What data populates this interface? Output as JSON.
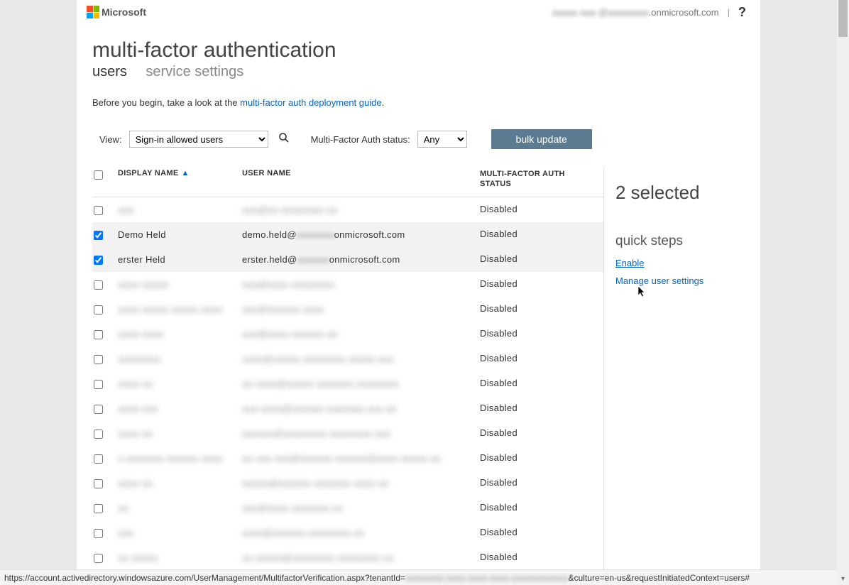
{
  "header": {
    "logo_text": "Microsoft",
    "email_prefix_blur": "aaaaa aaa @aaaaaaaa",
    "email_suffix": ".onmicrosoft.com",
    "separator": "|",
    "help": "?"
  },
  "page": {
    "title": "multi-factor authentication",
    "tab_users": "users",
    "tab_settings": "service settings"
  },
  "intro": {
    "before_text": "Before you begin, take a look at the ",
    "link_text": "multi-factor auth deployment guide",
    "after_text": "."
  },
  "filters": {
    "view_label": "View:",
    "view_value": "Sign-in allowed users",
    "mfa_label": "Multi-Factor Auth status:",
    "mfa_value": "Any",
    "bulk_button": "bulk update"
  },
  "columns": {
    "display_name": "DISPLAY NAME",
    "user_name": "USER NAME",
    "mfa_status": "MULTI-FACTOR AUTH STATUS"
  },
  "rows": [
    {
      "checked": false,
      "name_blur": "aaa",
      "user_blur": "aaa@aa aaaaaaaa aa",
      "status": "Disabled",
      "clear": false
    },
    {
      "checked": true,
      "name": "Demo Held",
      "user_prefix": "demo.held@",
      "user_mid_blur": "aaaaaaa",
      "user_suffix": "onmicrosoft.com",
      "status": "Disabled",
      "clear": true
    },
    {
      "checked": true,
      "name": "erster Held",
      "user_prefix": "erster.held@",
      "user_mid_blur": "aaaaaa",
      "user_suffix": "onmicrosoft.com",
      "status": "Disabled",
      "clear": true
    },
    {
      "checked": false,
      "name_blur": "aaaa aaaaa",
      "user_blur": "aaa@aaaa aaaaaaaa",
      "status": "Disabled",
      "clear": false
    },
    {
      "checked": false,
      "name_blur": "aaaa aaaaa  aaaaa aaaa",
      "user_blur": "aaa@aaaaaa aaaa",
      "status": "Disabled",
      "clear": false
    },
    {
      "checked": false,
      "name_blur": "aaaa aaaa",
      "user_blur": "aaa@aaaa aaaaaa aa",
      "status": "Disabled",
      "clear": false
    },
    {
      "checked": false,
      "name_blur": "aaaaaaaa",
      "user_blur": "aaaa@aaaaa aaaaaaaa aaaaa aaa",
      "status": "Disabled",
      "clear": false
    },
    {
      "checked": false,
      "name_blur": "aaaa aa",
      "user_blur": "aa aaaa@aaaaa aaaaaaa aaaaaaaa",
      "status": "Disabled",
      "clear": false
    },
    {
      "checked": false,
      "name_blur": "aaaa aaa",
      "user_blur": "aaa aaaa@aaaaaa aaaaaaa aaa aa",
      "status": "Disabled",
      "clear": false
    },
    {
      "checked": false,
      "name_blur": "aaaa aa",
      "user_blur": "aaaaaa@aaaaaaaa aaaaaaaa aaa",
      "status": "Disabled",
      "clear": false
    },
    {
      "checked": false,
      "name_blur": "a aaaaaaa aaaaaa aaaa",
      "user_blur": "aa aaa aaa@aaaaaa aaaaaa@aaaa aaaaa aa",
      "status": "Disabled",
      "clear": false
    },
    {
      "checked": false,
      "name_blur": "aaaa aa",
      "user_blur": "aaaaa@aaaaaa aaaaaaa aaaa aa",
      "status": "Disabled",
      "clear": false
    },
    {
      "checked": false,
      "name_blur": "aa",
      "user_blur": "aaa@aaaa aaaaaaa aa",
      "status": "Disabled",
      "clear": false
    },
    {
      "checked": false,
      "name_blur": "aaa",
      "user_blur": "aaaa@aaaaaa aaaaaaaa aa",
      "status": "Disabled",
      "clear": false
    },
    {
      "checked": false,
      "name_blur": "aa aaaaa",
      "user_blur": "aa aaaaa@aaaaaaaa aaaaaaaa aa",
      "status": "Disabled",
      "clear": false
    }
  ],
  "side": {
    "selected_title": "2 selected",
    "quick_steps": "quick steps",
    "enable": "Enable",
    "manage": "Manage user settings"
  },
  "status_bar": {
    "prefix": "https://account.activedirectory.windowsazure.com/UserManagement/MultifactorVerification.aspx?tenantId=",
    "mid_blur": "aaaaaaaa-aaaa-aaaa-aaaa-aaaaaaaaaaaa",
    "suffix": "&culture=en-us&requestInitiatedContext=users#"
  }
}
